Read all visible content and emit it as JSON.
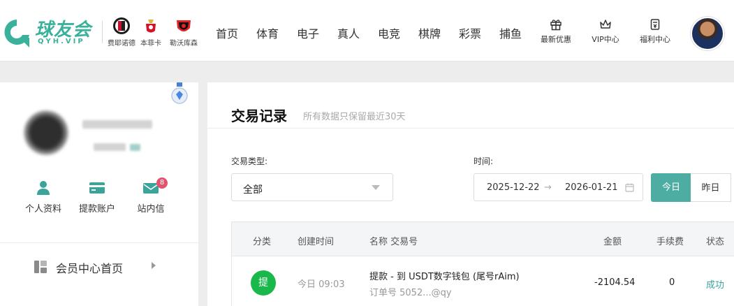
{
  "brand": {
    "name_cn": "球友会",
    "name_en": "QYH.VIP",
    "accent": "#3ab19b"
  },
  "clubs": [
    {
      "name": "费耶诺德",
      "icon": "feyenoord-crest-icon"
    },
    {
      "name": "本菲卡",
      "icon": "benfica-crest-icon"
    },
    {
      "name": "勒沃库森",
      "icon": "leverkusen-crest-icon"
    }
  ],
  "nav": {
    "items": [
      "首页",
      "体育",
      "电子",
      "真人",
      "电竞",
      "棋牌",
      "彩票",
      "捕鱼"
    ],
    "promos": [
      {
        "label": "最新优惠",
        "icon": "gift-icon"
      },
      {
        "label": "VIP中心",
        "icon": "crown-icon"
      },
      {
        "label": "福利中心",
        "icon": "welfare-icon"
      }
    ]
  },
  "profile": {
    "quick_links": [
      {
        "label": "个人资料",
        "icon": "user-icon"
      },
      {
        "label": "提款账户",
        "icon": "card-icon"
      },
      {
        "label": "站内信",
        "icon": "mail-icon",
        "count": "8"
      }
    ],
    "menu_home": "会员中心首页"
  },
  "page": {
    "title": "交易记录",
    "subtitle": "所有数据只保留最近30天"
  },
  "filters": {
    "type_label": "交易类型:",
    "type_value": "全部",
    "time_label": "时间:",
    "date_start": "2025-12-22",
    "date_arrow": "→",
    "date_end": "2026-01-21",
    "today": "今日",
    "yesterday": "昨日"
  },
  "table": {
    "headers": {
      "category": "分类",
      "created": "创建时间",
      "name": "名称 交易号",
      "amount": "金额",
      "fee": "手续费",
      "status": "状态"
    },
    "rows": [
      {
        "category": "提",
        "time": "今日 09:03",
        "name": "提款 - 到 USDT数字钱包 (尾号rAim)",
        "order": "订单号 5052...@qy",
        "amount": "-2104.54",
        "fee": "0",
        "status": "成功"
      }
    ]
  },
  "colors": {
    "teal": "#4eada3",
    "green_badge": "#18b84a",
    "success_text": "#3aa39a",
    "msg_badge": "#e05470"
  }
}
